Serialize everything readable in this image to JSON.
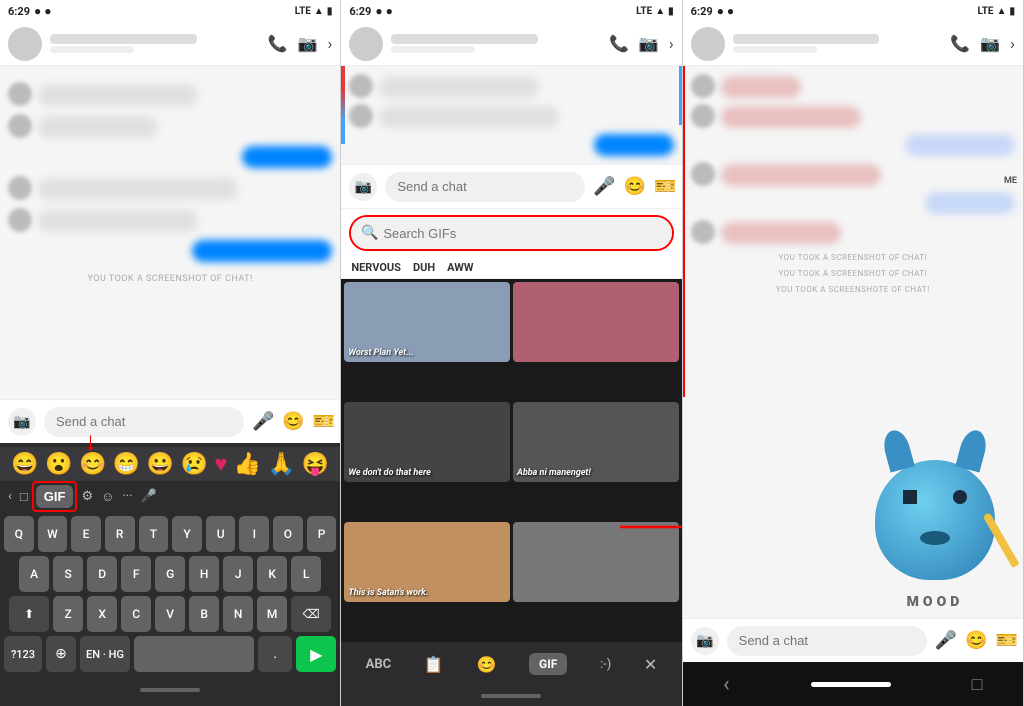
{
  "panels": [
    {
      "id": "panel1",
      "status_bar": {
        "time": "6:29",
        "carrier": "LTE",
        "icons": [
          "signal",
          "wifi",
          "battery"
        ]
      },
      "header": {
        "avatar": "",
        "name_placeholder": true
      },
      "chat_messages": [
        {
          "type": "other",
          "width": "w2"
        },
        {
          "type": "other",
          "width": "w1"
        },
        {
          "type": "other",
          "width": "w3"
        },
        {
          "type": "me",
          "width": "w4"
        },
        {
          "type": "other",
          "width": "w2"
        },
        {
          "type": "other",
          "width": "w5"
        }
      ],
      "screenshot_notice": "YOU TOOK A SCREENSHOT OF CHAT!",
      "input_placeholder": "Send a chat",
      "keyboard": {
        "emoji_row": [
          "😄",
          "😮",
          "😊",
          "😁",
          "😀",
          "😢",
          "👍",
          "🙏",
          "😝"
        ],
        "tools": [
          "gif_btn",
          "settings",
          "sticker",
          "more",
          "mic"
        ],
        "gif_label": "GIF",
        "rows": [
          [
            "Q",
            "W",
            "E",
            "R",
            "T",
            "Y",
            "U",
            "I",
            "O",
            "P"
          ],
          [
            "A",
            "S",
            "D",
            "F",
            "G",
            "H",
            "J",
            "K",
            "L"
          ],
          [
            "⬆",
            "Z",
            "X",
            "C",
            "V",
            "B",
            "N",
            "M",
            "⌫"
          ]
        ],
        "bottom_row": [
          "?123",
          "☺",
          "⊕",
          "EN · HG",
          ".",
          "▶"
        ]
      }
    },
    {
      "id": "panel2",
      "status_bar": {
        "time": "6:29",
        "carrier": "LTE"
      },
      "header": {
        "name_placeholder": true
      },
      "chat_messages": [
        {
          "type": "other",
          "width": "w2"
        },
        {
          "type": "other",
          "width": "w1"
        },
        {
          "type": "me",
          "width": "w4"
        },
        {
          "type": "other",
          "width": "w2"
        },
        {
          "type": "me",
          "width": "w3"
        }
      ],
      "input_placeholder": "Send a chat",
      "gif_search_placeholder": "Search GIFs",
      "gif_tags": [
        "NERVOUS",
        "DUH",
        "AWW"
      ],
      "gif_items": [
        {
          "label": "Worst Plan Yet...",
          "bg": "gif-bg-1"
        },
        {
          "label": "",
          "bg": "gif-bg-2"
        },
        {
          "label": "We don't do that here",
          "bg": "gif-bg-3"
        },
        {
          "label": "Abba ni manenget!",
          "bg": "gif-bg-4"
        },
        {
          "label": "This is Satan's work.",
          "bg": "gif-bg-5"
        },
        {
          "label": "",
          "bg": "gif-bg-6"
        }
      ],
      "keyboard2": {
        "buttons": [
          "ABC",
          "sticker",
          "emoji",
          "GIF",
          ":-)",
          "close"
        ]
      }
    },
    {
      "id": "panel3",
      "status_bar": {
        "time": "6:29",
        "carrier": "LTE"
      },
      "header": {
        "name_placeholder": true
      },
      "chat_messages": [
        {
          "type": "other",
          "width": "w1"
        },
        {
          "type": "other",
          "width": "w3"
        },
        {
          "type": "me",
          "width": "w2"
        },
        {
          "type": "other",
          "width": "w4"
        },
        {
          "type": "me",
          "width": "w3"
        },
        {
          "type": "other",
          "width": "w2"
        }
      ],
      "screenshot_notices": [
        "YOU TOOK A SCREENSHOT OF CHAT!",
        "YOU TOOK A SCREENSHOT OF CHAT!",
        "YOU TOOK A SCREENSHOTE OF CHAT!"
      ],
      "sticker_mood": "MOOD",
      "me_label": "ME",
      "input_placeholder": "Send a chat",
      "nav": {
        "back": "‹",
        "home_bar": true
      }
    }
  ],
  "red_annotations": {
    "arrow1_label": "↓",
    "box1_label": "GIF button highlighted",
    "box2_label": "Search GIFs highlighted",
    "arrow2_label": "→ sticker sent"
  }
}
